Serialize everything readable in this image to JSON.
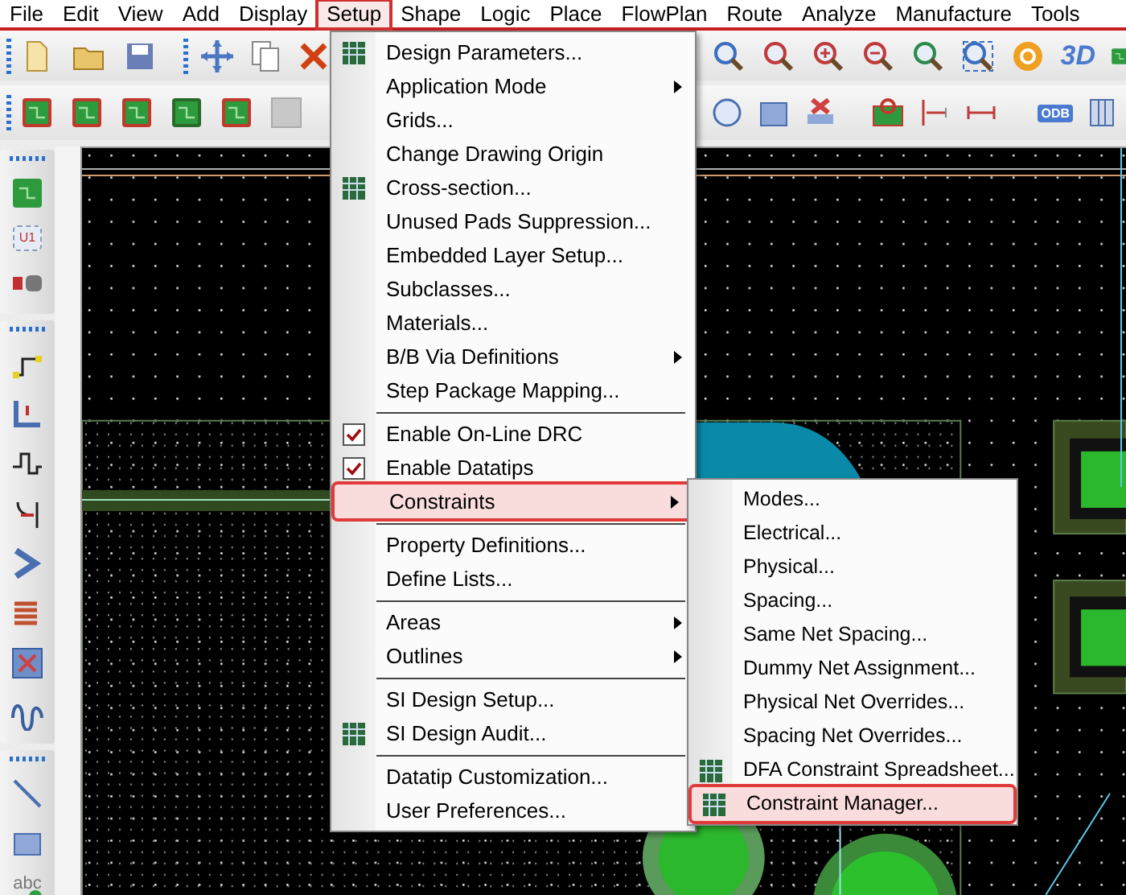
{
  "menubar": [
    {
      "label": "File",
      "selected": false
    },
    {
      "label": "Edit",
      "selected": false
    },
    {
      "label": "View",
      "selected": false
    },
    {
      "label": "Add",
      "selected": false
    },
    {
      "label": "Display",
      "selected": false
    },
    {
      "label": "Setup",
      "selected": true
    },
    {
      "label": "Shape",
      "selected": false
    },
    {
      "label": "Logic",
      "selected": false
    },
    {
      "label": "Place",
      "selected": false
    },
    {
      "label": "FlowPlan",
      "selected": false
    },
    {
      "label": "Route",
      "selected": false
    },
    {
      "label": "Analyze",
      "selected": false
    },
    {
      "label": "Manufacture",
      "selected": false
    },
    {
      "label": "Tools",
      "selected": false
    }
  ],
  "icon_texts": {
    "view_3d": "3D",
    "odb": "ODB",
    "chip": "U1",
    "text_tool": "abc"
  },
  "setup_menu": {
    "items": [
      {
        "label": "Design Parameters...",
        "kind": "icon",
        "checked": false,
        "submenu": false,
        "separator_before": false,
        "selected": false
      },
      {
        "label": "Application Mode",
        "kind": "plain",
        "checked": false,
        "submenu": true,
        "separator_before": false,
        "selected": false
      },
      {
        "label": "Grids...",
        "kind": "plain",
        "checked": false,
        "submenu": false,
        "separator_before": false,
        "selected": false
      },
      {
        "label": "Change Drawing Origin",
        "kind": "plain",
        "checked": false,
        "submenu": false,
        "separator_before": false,
        "selected": false
      },
      {
        "label": "Cross-section...",
        "kind": "icon",
        "checked": false,
        "submenu": false,
        "separator_before": false,
        "selected": false
      },
      {
        "label": "Unused Pads Suppression...",
        "kind": "plain",
        "checked": false,
        "submenu": false,
        "separator_before": false,
        "selected": false
      },
      {
        "label": "Embedded Layer Setup...",
        "kind": "plain",
        "checked": false,
        "submenu": false,
        "separator_before": false,
        "selected": false
      },
      {
        "label": "Subclasses...",
        "kind": "plain",
        "checked": false,
        "submenu": false,
        "separator_before": false,
        "selected": false
      },
      {
        "label": "Materials...",
        "kind": "plain",
        "checked": false,
        "submenu": false,
        "separator_before": false,
        "selected": false
      },
      {
        "label": "B/B Via Definitions",
        "kind": "plain",
        "checked": false,
        "submenu": true,
        "separator_before": false,
        "selected": false
      },
      {
        "label": "Step Package Mapping...",
        "kind": "plain",
        "checked": false,
        "submenu": false,
        "separator_before": false,
        "selected": false
      },
      {
        "label": "Enable On-Line DRC",
        "kind": "plain",
        "checked": true,
        "submenu": false,
        "separator_before": true,
        "selected": false
      },
      {
        "label": "Enable Datatips",
        "kind": "plain",
        "checked": true,
        "submenu": false,
        "separator_before": false,
        "selected": false
      },
      {
        "label": "Constraints",
        "kind": "plain",
        "checked": false,
        "submenu": true,
        "separator_before": false,
        "selected": true
      },
      {
        "label": "Property Definitions...",
        "kind": "plain",
        "checked": false,
        "submenu": false,
        "separator_before": true,
        "selected": false
      },
      {
        "label": "Define Lists...",
        "kind": "plain",
        "checked": false,
        "submenu": false,
        "separator_before": false,
        "selected": false
      },
      {
        "label": "Areas",
        "kind": "plain",
        "checked": false,
        "submenu": true,
        "separator_before": true,
        "selected": false
      },
      {
        "label": "Outlines",
        "kind": "plain",
        "checked": false,
        "submenu": true,
        "separator_before": false,
        "selected": false
      },
      {
        "label": "SI Design Setup...",
        "kind": "plain",
        "checked": false,
        "submenu": false,
        "separator_before": true,
        "selected": false
      },
      {
        "label": "SI Design Audit...",
        "kind": "icon",
        "checked": false,
        "submenu": false,
        "separator_before": false,
        "selected": false
      },
      {
        "label": "Datatip Customization...",
        "kind": "plain",
        "checked": false,
        "submenu": false,
        "separator_before": true,
        "selected": false
      },
      {
        "label": "User Preferences...",
        "kind": "plain",
        "checked": false,
        "submenu": false,
        "separator_before": false,
        "selected": false
      }
    ]
  },
  "constraints_submenu": {
    "items": [
      {
        "label": "Modes...",
        "kind": "plain",
        "selected": false
      },
      {
        "label": "Electrical...",
        "kind": "plain",
        "selected": false
      },
      {
        "label": "Physical...",
        "kind": "plain",
        "selected": false
      },
      {
        "label": "Spacing...",
        "kind": "plain",
        "selected": false
      },
      {
        "label": "Same Net Spacing...",
        "kind": "plain",
        "selected": false
      },
      {
        "label": "Dummy Net Assignment...",
        "kind": "plain",
        "selected": false
      },
      {
        "label": "Physical Net Overrides...",
        "kind": "plain",
        "selected": false
      },
      {
        "label": "Spacing Net Overrides...",
        "kind": "plain",
        "selected": false
      },
      {
        "label": "DFA Constraint Spreadsheet...",
        "kind": "icon",
        "selected": false
      },
      {
        "label": "Constraint Manager...",
        "kind": "icon",
        "selected": true
      }
    ]
  }
}
